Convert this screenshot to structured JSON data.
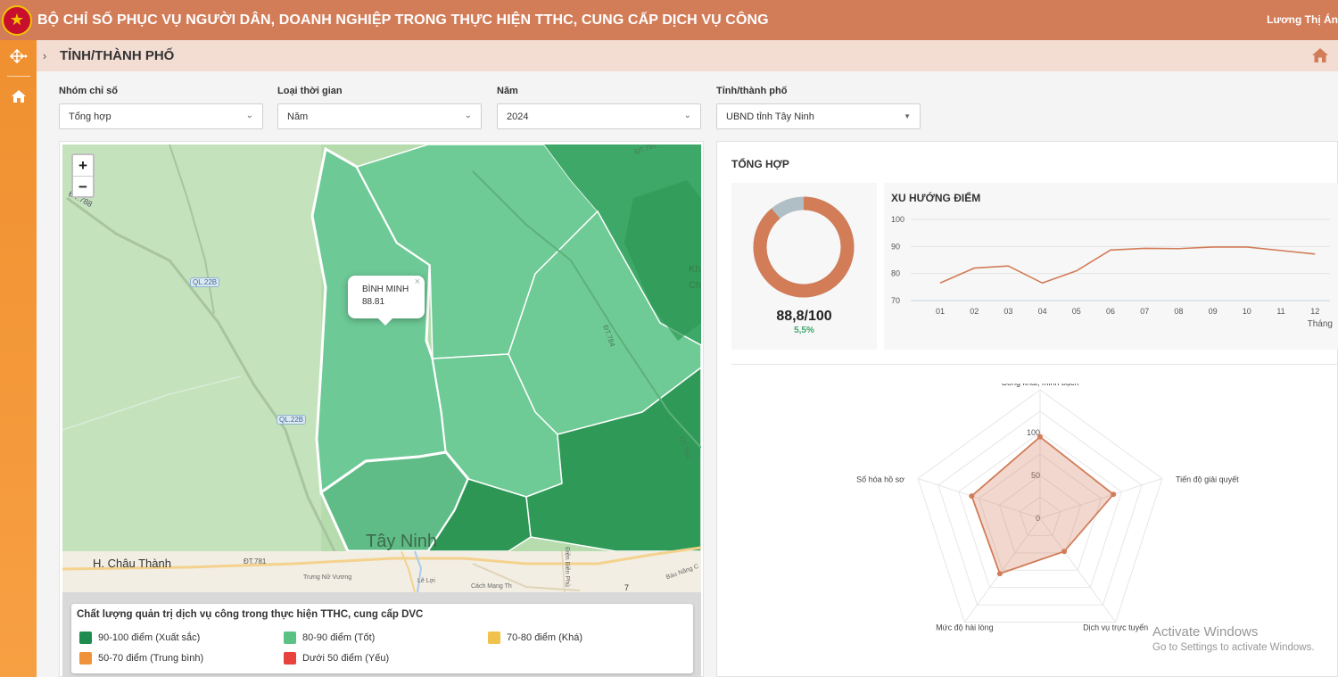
{
  "header": {
    "title": "BỘ CHỈ SỐ PHỤC VỤ NGƯỜI DÂN, DOANH NGHIỆP TRONG THỰC HIỆN TTHC, CUNG CẤP DỊCH VỤ CÔNG",
    "user": "Lương Thị Án",
    "color": "#d27c58"
  },
  "sidebar": {
    "items": [
      {
        "icon": "move-icon"
      },
      {
        "icon": "home-icon"
      }
    ],
    "color": "#f09030"
  },
  "breadcrumb": {
    "title": "TỈNH/THÀNH PHỐ",
    "toggle": "›",
    "home_icon": "home-icon"
  },
  "filters": [
    {
      "label": "Nhóm chỉ số",
      "value": "Tổng hợp"
    },
    {
      "label": "Loại thời gian",
      "value": "Năm"
    },
    {
      "label": "Năm",
      "value": "2024"
    },
    {
      "label": "Tỉnh/thành phố",
      "value": "UBND tỉnh Tây Ninh"
    }
  ],
  "map": {
    "zoom_in": "+",
    "zoom_out": "−",
    "popup": {
      "name": "BÌNH MINH",
      "value": "88.81",
      "close": "×"
    },
    "labels": {
      "dt788": "ĐT.788",
      "ql22b_a": "QL.22B",
      "ql22b_b": "QL.22B",
      "dt784_a": "ĐT.784",
      "dt784_b": "ĐT.784",
      "dt781_top": "ĐT.781",
      "dt781": "ĐT.781",
      "city": "Tây Ninh",
      "district": "H. Châu Thành",
      "street1": "Trưng Nữ Vương",
      "street2": "Lê Lợi",
      "street3": "Cách Mạng Th",
      "street4": "Bàu Năng C",
      "street5": "Điện Biên Phủ",
      "kh": "Kh",
      "ch": "Ch",
      "sev": "7"
    }
  },
  "legend": {
    "title": "Chất lượng quản trị dịch vụ công trong thực hiện TTHC, cung cấp DVC",
    "items": [
      {
        "label": "90-100 điểm (Xuất sắc)",
        "color": "#1e8c4e"
      },
      {
        "label": "80-90 điểm (Tốt)",
        "color": "#5cc184"
      },
      {
        "label": "70-80 điểm (Khá)",
        "color": "#f0c14b"
      },
      {
        "label": "50-70 điểm (Trung bình)",
        "color": "#f0923a"
      },
      {
        "label": "Dưới 50 điểm (Yếu)",
        "color": "#e8423f"
      }
    ]
  },
  "summary": {
    "title": "TỔNG HỢP",
    "score": "88,8/100",
    "change": "5,5%",
    "score_value": 88.8,
    "score_max": 100,
    "ring_colors": {
      "score": "#d27c58",
      "rest": "#b0bec5"
    }
  },
  "trend": {
    "title": "XU HƯỚNG ĐIỂM"
  },
  "chart_data": [
    {
      "type": "line",
      "title": "XU HƯỚNG ĐIỂM",
      "xlabel": "Tháng",
      "ylabel": "",
      "x": [
        "01",
        "02",
        "03",
        "04",
        "05",
        "06",
        "07",
        "08",
        "09",
        "10",
        "11",
        "12"
      ],
      "yticks": [
        "100",
        "90",
        "80",
        "70"
      ],
      "ylim": [
        70,
        100
      ],
      "series": [
        {
          "values": [
            76.5,
            82,
            82.8,
            76.5,
            81,
            88.7,
            89.3,
            89.2,
            89.8,
            89.8,
            88.5,
            87.2
          ],
          "color": "#d27c58"
        }
      ],
      "grid": true
    },
    {
      "type": "radar",
      "axes": [
        "Công khai, minh bạch",
        "Tiến độ giải quyết",
        "Dịch vụ trực tuyến",
        "Mức độ hài lòng",
        "Số hóa hồ sơ"
      ],
      "rticks": [
        "100",
        "50",
        "0"
      ],
      "rlim": [
        0,
        150
      ],
      "series": [
        {
          "values": [
            95,
            90,
            48,
            80,
            84
          ],
          "color": "#d27c58"
        }
      ]
    }
  ],
  "radar": {
    "axis_labels": [
      "Công khai, minh bạch",
      "Tiến độ giải quyết",
      "Dịch vụ trực tuyến",
      "Mức độ hài lòng",
      "Số hóa hồ sơ"
    ],
    "ticks": [
      "100",
      "50",
      "0"
    ]
  },
  "watermark": {
    "line1": "Activate Windows",
    "line2": "Go to Settings to activate Windows."
  }
}
